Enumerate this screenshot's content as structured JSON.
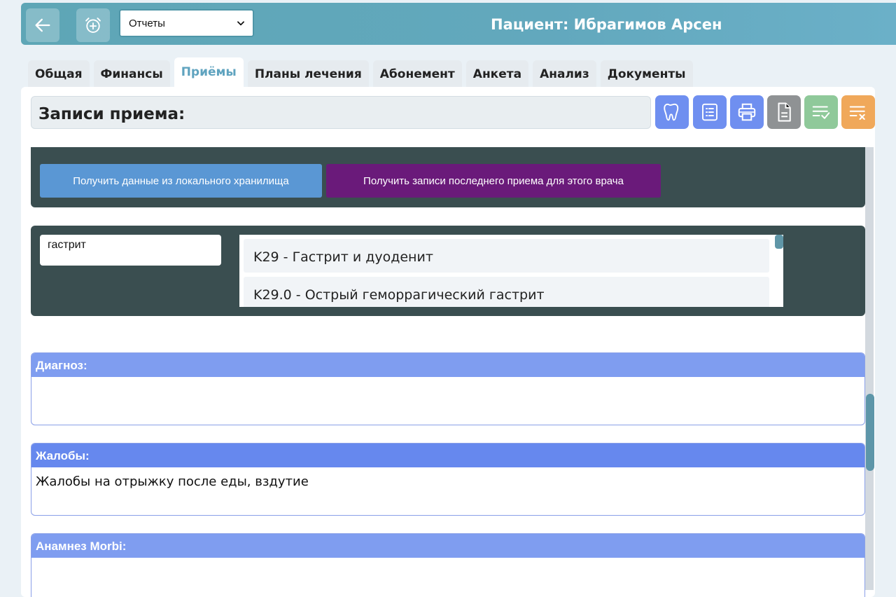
{
  "header": {
    "report_select": "Отчеты",
    "patient_title": "Пациент: Ибрагимов Арсен"
  },
  "tabs": [
    {
      "label": "Общая"
    },
    {
      "label": "Финансы"
    },
    {
      "label": "Приёмы",
      "active": true
    },
    {
      "label": "Планы лечения"
    },
    {
      "label": "Абонемент"
    },
    {
      "label": "Анкета"
    },
    {
      "label": "Анализ"
    },
    {
      "label": "Документы"
    }
  ],
  "records": {
    "title": "Записи приема:",
    "toolbar_icons": [
      "tooth-icon",
      "list-icon",
      "printer-icon",
      "document-icon",
      "checklist-icon",
      "clear-list-icon"
    ],
    "toolbar_colors": [
      "#6f8ff0",
      "#6f8ff0",
      "#6f8ff0",
      "#8f9294",
      "#8fc99a",
      "#f0a85a"
    ]
  },
  "actions": {
    "local_storage": "Получить данные из локального хранилища",
    "last_visit": "Получить записи последнего приема для этого врача"
  },
  "diagnosis_search": {
    "value": "гастрит",
    "suggestions": [
      "K29 - Гастрит и дуоденит",
      "K29.0 - Острый геморрагический гастрит"
    ]
  },
  "sections": [
    {
      "title": "Диагноз:",
      "value": "",
      "color": "#7f9df0"
    },
    {
      "title": "Жалобы:",
      "value": "Жалобы на отрыжку после еды, вздутие",
      "color": "#6688ee"
    },
    {
      "title": "Анамнез Morbi:",
      "value": "",
      "color": "#7f9df0"
    }
  ]
}
